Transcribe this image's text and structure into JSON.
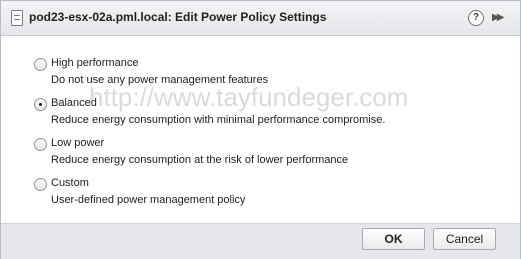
{
  "dialog": {
    "title": "pod23-esx-02a.pml.local: Edit Power Policy Settings",
    "help_label": "?",
    "forward_label": "▶▶"
  },
  "options": [
    {
      "label": "High performance",
      "description": "Do not use any power management features",
      "selected": false
    },
    {
      "label": "Balanced",
      "description": "Reduce energy consumption with minimal performance compromise.",
      "selected": true
    },
    {
      "label": "Low power",
      "description": "Reduce energy consumption at the risk of lower performance",
      "selected": false
    },
    {
      "label": "Custom",
      "description": "User-defined power management policy",
      "selected": false
    }
  ],
  "watermark": "http://www.tayfundeger.com",
  "footer": {
    "ok_label": "OK",
    "cancel_label": "Cancel"
  }
}
